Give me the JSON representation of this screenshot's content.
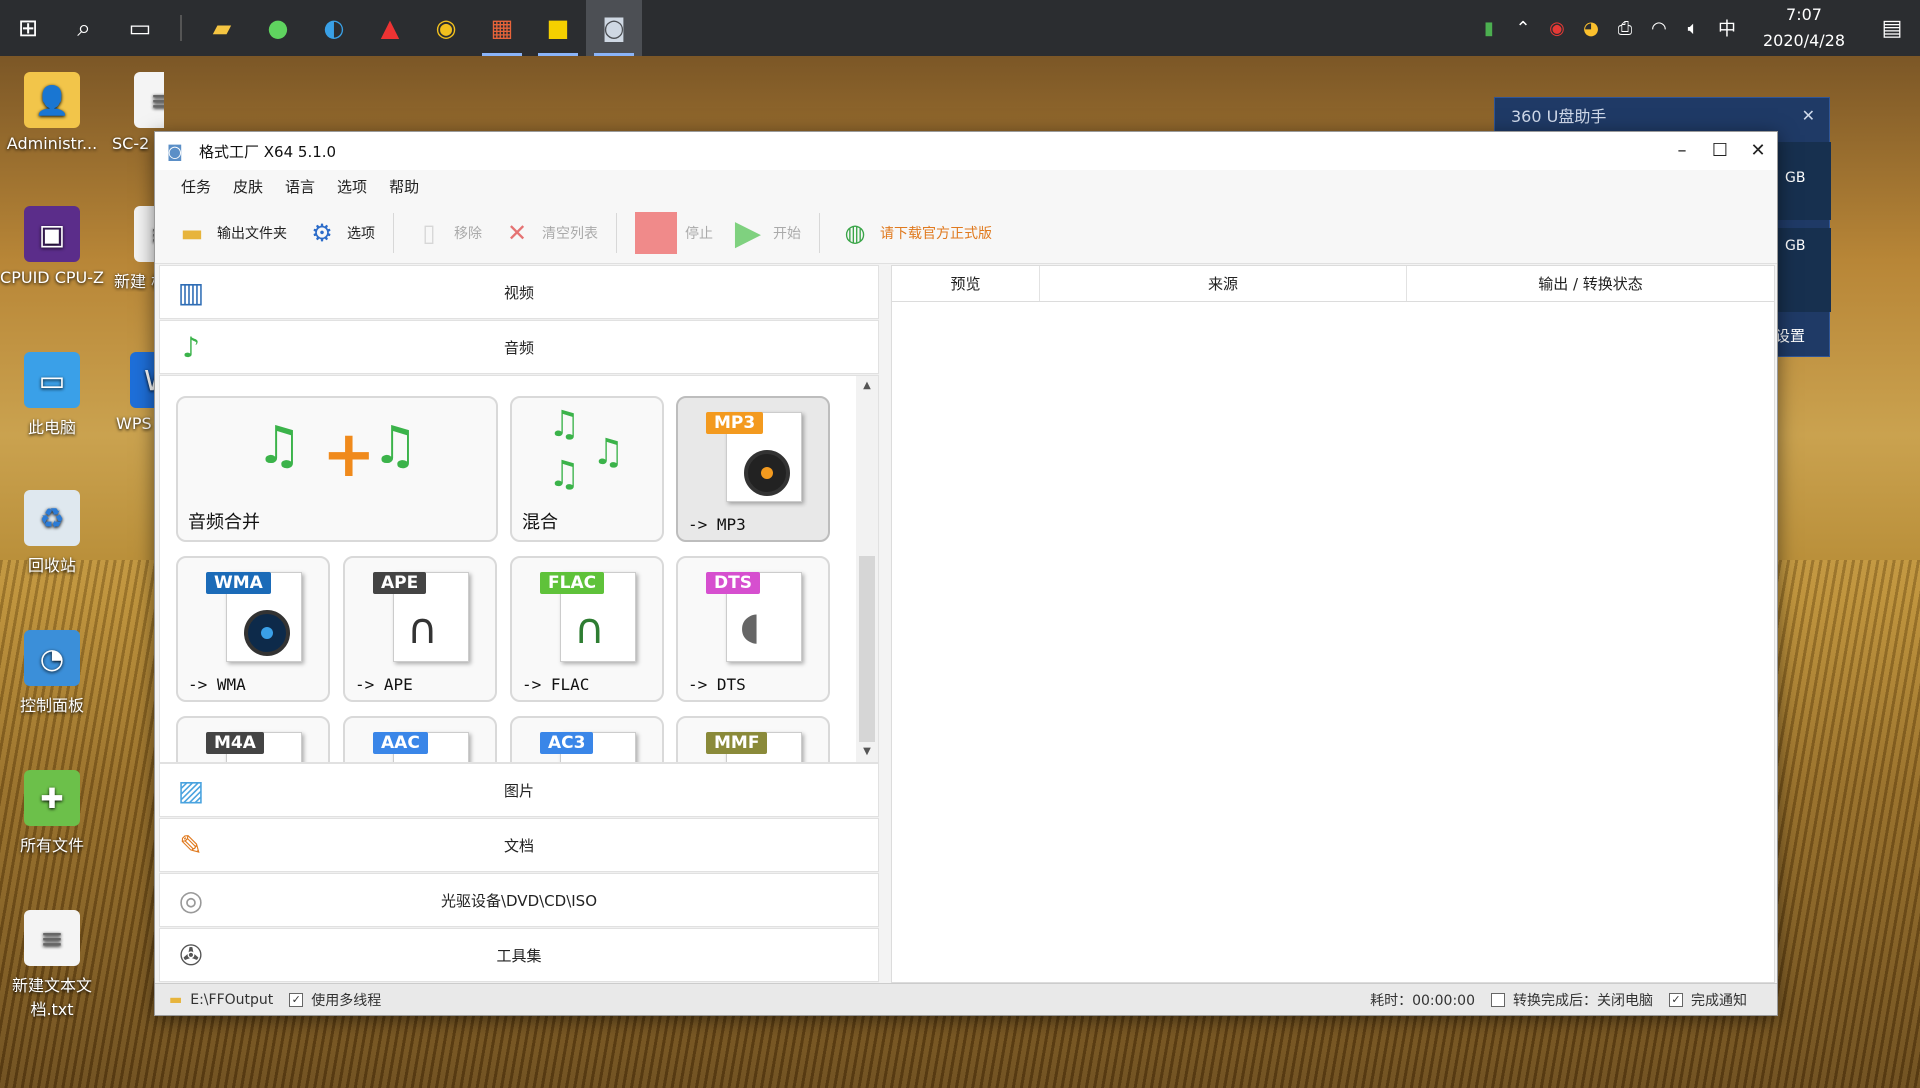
{
  "taskbar": {
    "apps": [
      "start-icon",
      "search-icon",
      "task-view-icon",
      "file-explorer-icon",
      "wechat-icon",
      "edge-icon",
      "warning-app-icon",
      "chrome-icon",
      "office-icon",
      "player-icon",
      "format-factory-icon"
    ],
    "clock_time": "7:07",
    "clock_date": "2020/4/28",
    "ime": "中"
  },
  "desktop": {
    "icons": [
      {
        "label": "Administr..."
      },
      {
        "label": "SC-2"
      },
      {
        "label": "CPUID CPU-Z"
      },
      {
        "label": "新建 档(1"
      },
      {
        "label": "此电脑"
      },
      {
        "label": "WPS"
      },
      {
        "label": "回收站"
      },
      {
        "label": "控制面板"
      },
      {
        "label": "所有文件"
      },
      {
        "label": "新建文本文档.txt"
      }
    ]
  },
  "popup360": {
    "title": "360 U盘助手",
    "gb1": "GB",
    "gb2": "GB",
    "settings": "设置"
  },
  "window": {
    "title": "格式工厂 X64 5.1.0",
    "menu": [
      "任务",
      "皮肤",
      "语言",
      "选项",
      "帮助"
    ],
    "toolbar": {
      "output_folder": "输出文件夹",
      "options": "选项",
      "remove": "移除",
      "clear_list": "清空列表",
      "stop": "停止",
      "start": "开始",
      "download": "请下载官方正式版"
    },
    "categories": {
      "video": "视频",
      "audio": "音频",
      "image": "图片",
      "document": "文档",
      "disc": "光驱设备\\DVD\\CD\\ISO",
      "tools": "工具集"
    },
    "audio_tiles": {
      "merge": "音频合并",
      "mix": "混合",
      "mp3": "-> MP3",
      "mp3_badge": "MP3",
      "wma": "-> WMA",
      "wma_badge": "WMA",
      "ape": "-> APE",
      "ape_badge": "APE",
      "flac": "-> FLAC",
      "flac_badge": "FLAC",
      "dts": "-> DTS",
      "dts_badge": "DTS",
      "m4a_badge": "M4A",
      "aac_badge": "AAC",
      "ac3_badge": "AC3",
      "mmf_badge": "MMF"
    },
    "table_headers": {
      "preview": "预览",
      "source": "来源",
      "output": "输出 / 转换状态"
    },
    "status": {
      "path": "E:\\FFOutput",
      "multithread": "使用多线程",
      "elapsed": "耗时：00:00:00",
      "after_convert": "转换完成后：关闭电脑",
      "notify": "完成通知"
    }
  }
}
